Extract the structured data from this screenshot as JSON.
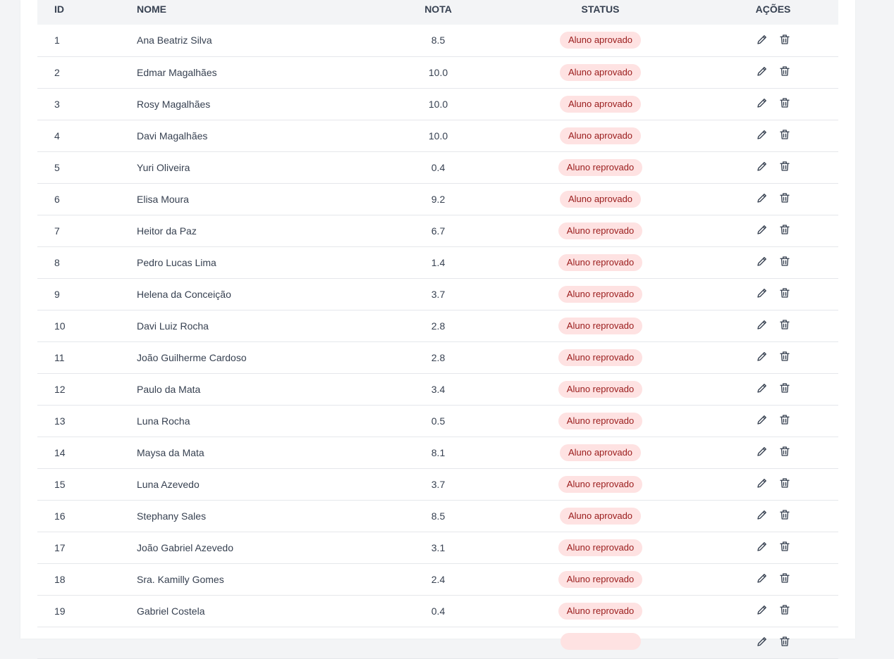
{
  "table": {
    "headers": {
      "id": "ID",
      "nome": "NOME",
      "nota": "NOTA",
      "status": "STATUS",
      "acoes": "AÇÕES"
    },
    "rows": [
      {
        "id": "1",
        "nome": "Ana Beatriz Silva",
        "nota": "8.5",
        "status": "Aluno aprovado"
      },
      {
        "id": "2",
        "nome": "Edmar Magalhães",
        "nota": "10.0",
        "status": "Aluno aprovado"
      },
      {
        "id": "3",
        "nome": "Rosy Magalhães",
        "nota": "10.0",
        "status": "Aluno aprovado"
      },
      {
        "id": "4",
        "nome": "Davi Magalhães",
        "nota": "10.0",
        "status": "Aluno aprovado"
      },
      {
        "id": "5",
        "nome": "Yuri Oliveira",
        "nota": "0.4",
        "status": "Aluno reprovado"
      },
      {
        "id": "6",
        "nome": "Elisa Moura",
        "nota": "9.2",
        "status": "Aluno aprovado"
      },
      {
        "id": "7",
        "nome": "Heitor da Paz",
        "nota": "6.7",
        "status": "Aluno reprovado"
      },
      {
        "id": "8",
        "nome": "Pedro Lucas Lima",
        "nota": "1.4",
        "status": "Aluno reprovado"
      },
      {
        "id": "9",
        "nome": "Helena da Conceição",
        "nota": "3.7",
        "status": "Aluno reprovado"
      },
      {
        "id": "10",
        "nome": "Davi Luiz Rocha",
        "nota": "2.8",
        "status": "Aluno reprovado"
      },
      {
        "id": "11",
        "nome": "João Guilherme Cardoso",
        "nota": "2.8",
        "status": "Aluno reprovado"
      },
      {
        "id": "12",
        "nome": "Paulo da Mata",
        "nota": "3.4",
        "status": "Aluno reprovado"
      },
      {
        "id": "13",
        "nome": "Luna Rocha",
        "nota": "0.5",
        "status": "Aluno reprovado"
      },
      {
        "id": "14",
        "nome": "Maysa da Mata",
        "nota": "8.1",
        "status": "Aluno aprovado"
      },
      {
        "id": "15",
        "nome": "Luna Azevedo",
        "nota": "3.7",
        "status": "Aluno reprovado"
      },
      {
        "id": "16",
        "nome": "Stephany Sales",
        "nota": "8.5",
        "status": "Aluno aprovado"
      },
      {
        "id": "17",
        "nome": "João Gabriel Azevedo",
        "nota": "3.1",
        "status": "Aluno reprovado"
      },
      {
        "id": "18",
        "nome": "Sra. Kamilly Gomes",
        "nota": "2.4",
        "status": "Aluno reprovado"
      },
      {
        "id": "19",
        "nome": "Gabriel Costela",
        "nota": "0.4",
        "status": "Aluno reprovado"
      },
      {
        "id": "",
        "nome": "",
        "nota": "",
        "status": ""
      }
    ],
    "row_actions": [
      "pencil-icon",
      "trash-icon"
    ]
  },
  "colors": {
    "page_bg": "#f3f4f6",
    "header_bg": "#f3f4f6",
    "badge_bg": "#fee2e2",
    "badge_text": "#991b1b",
    "text": "#374151"
  }
}
